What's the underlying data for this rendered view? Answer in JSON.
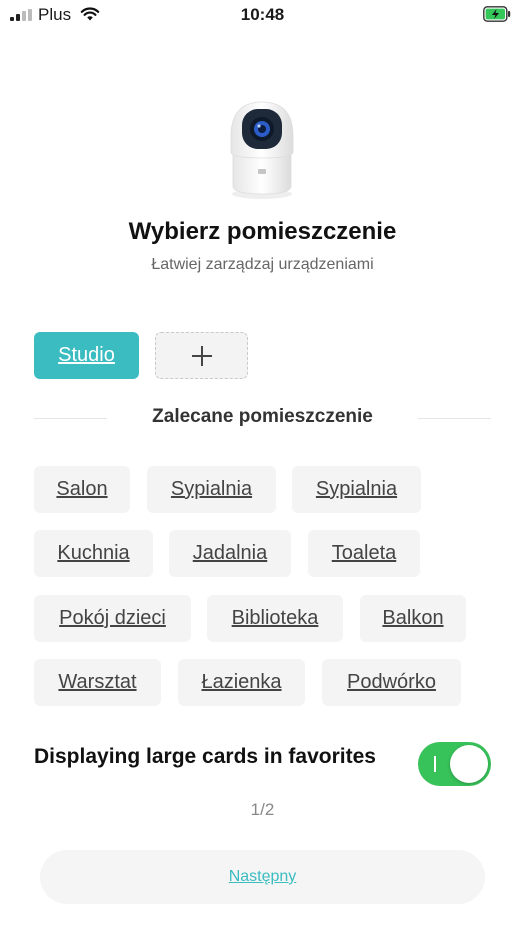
{
  "status_bar": {
    "carrier": "Plus",
    "time": "10:48"
  },
  "header": {
    "title": "Wybierz pomieszczenie",
    "subtitle": "Łatwiej zarządzaj urządzeniami"
  },
  "rooms": {
    "selected": "Studio"
  },
  "recommended": {
    "title": "Zalecane pomieszczenie",
    "items": [
      "Salon",
      "Sypialnia",
      "Sypialnia",
      "Kuchnia",
      "Jadalnia",
      "Toaleta",
      "Pokój dzieci",
      "Biblioteka",
      "Balkon",
      "Warsztat",
      "Łazienka",
      "Podwórko"
    ]
  },
  "favorites": {
    "label": "Displaying large cards in favorites",
    "enabled": true
  },
  "pager": {
    "text": "1/2"
  },
  "footer": {
    "next_label": "Następny"
  },
  "colors": {
    "accent": "#3bbcc1",
    "toggle_on": "#38c25a"
  }
}
